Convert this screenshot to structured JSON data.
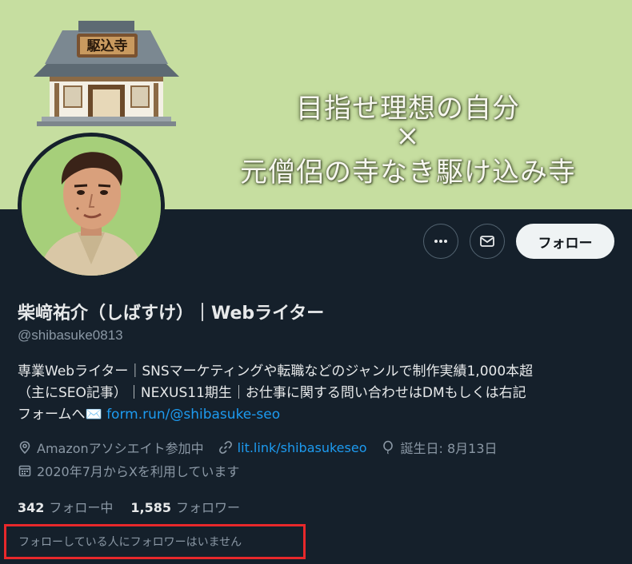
{
  "banner": {
    "line1": "目指せ理想の自分",
    "line2": "×",
    "line3": "元僧侶の寺なき駆け込み寺",
    "sign_text": "駆込寺",
    "background_color": "#c6dea0"
  },
  "profile": {
    "display_name": "柴﨑祐介（しばすけ）｜Webライター",
    "handle": "@shibasuke0813",
    "bio_line1": "専業Webライター｜SNSマーケティングや転職などのジャンルで制作実績1,000本超",
    "bio_line2": "（主にSEO記事）｜NEXUS11期生｜お仕事に関する問い合わせはDMもしくは右記",
    "bio_line3_prefix": "フォームへ✉️ ",
    "bio_link": "form.run/@shibasuke-seo"
  },
  "actions": {
    "more_icon": "more-horizontal-icon",
    "message_icon": "envelope-icon",
    "follow_label": "フォロー"
  },
  "meta": {
    "location": "Amazonアソシエイト参加中",
    "website": "lit.link/shibasukeseo",
    "birthday": "誕生日: 8月13日",
    "joined": "2020年7月からXを利用しています"
  },
  "stats": {
    "following_count": "342",
    "following_label": "フォロー中",
    "followers_count": "1,585",
    "followers_label": "フォロワー"
  },
  "notice": "フォローしている人にフォロワーはいません",
  "colors": {
    "background": "#15202b",
    "link": "#1d9bf0",
    "muted": "#8b98a5",
    "highlight_border": "#e8282b"
  }
}
